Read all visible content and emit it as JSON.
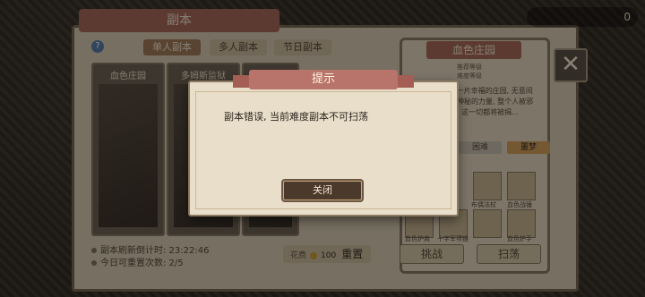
{
  "main_window": {
    "title": "副本",
    "tabs": [
      "单人副本",
      "多人副本",
      "节日副本"
    ],
    "active_tab": 0,
    "cards": [
      "血色庄园",
      "多姆斯监狱"
    ],
    "refresh_countdown": "副本刷新倒计时: 23:22:46",
    "resets_today": "今日可重置次数: 2/5",
    "cost_label": "花费",
    "cost_value": "100",
    "reset_button": "重置"
  },
  "side_panel": {
    "title": "血色庄园",
    "sub1": "推荐等级",
    "sub2": "难度等级",
    "description": "...兄弟一片幸福的庄园, 无意间发现了神秘的力量, 整个人被邪恶吞噬, 这一切都将被揭...",
    "pill_left": "困难",
    "pill_right": "噩梦",
    "items": [
      "布偶法杖",
      "血色战锤",
      "血色护肩",
      "十字军项链",
      "血色护手"
    ],
    "challenge_button": "挑战",
    "sweep_button": "扫荡"
  },
  "top_bar": {
    "currency_value": "0"
  },
  "dialog": {
    "title": "提示",
    "message": "副本错误, 当前难度副本不可扫荡",
    "button": "关闭"
  },
  "colors": {
    "ribbon": "#b8736a",
    "dialog_bg": "#e9dec9",
    "button_bg": "#4b3a2c"
  }
}
